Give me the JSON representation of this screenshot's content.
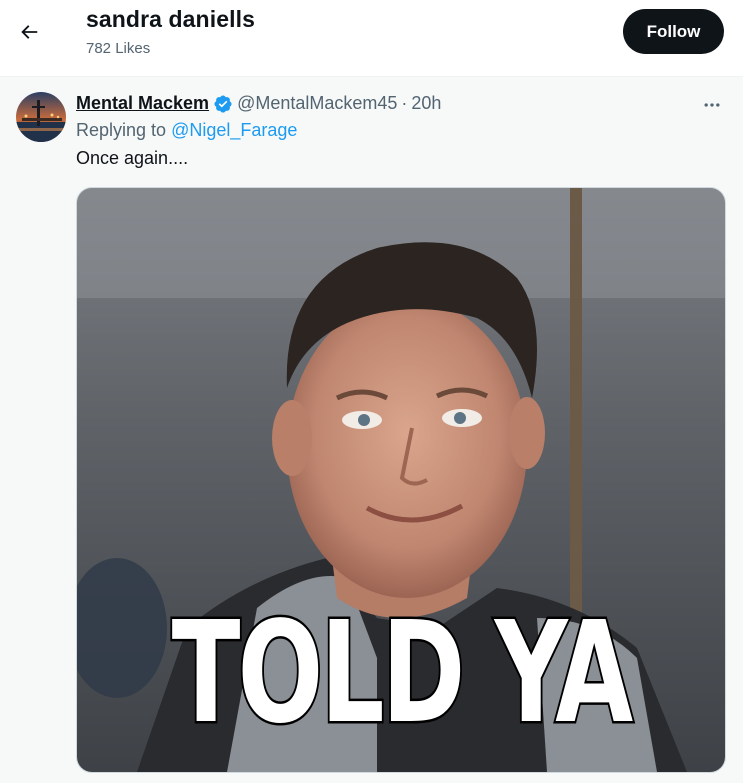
{
  "header": {
    "title": "sandra daniells",
    "likes_count": "782 Likes",
    "follow_label": "Follow",
    "back_icon": "arrow-left-icon"
  },
  "tweet": {
    "author": {
      "display_name": "Mental Mackem",
      "handle": "@MentalMackem45",
      "verified": true
    },
    "separator": "·",
    "time": "20h",
    "reply": {
      "prefix": "Replying to ",
      "target": "@Nigel_Farage"
    },
    "text": "Once again....",
    "media": {
      "caption": "TOLD YA"
    },
    "more_icon": "more-horizontal-icon"
  },
  "colors": {
    "link": "#1d9bf0",
    "verified": "#1d9bf0",
    "follow_bg": "#0f1419",
    "secondary_text": "#536471"
  }
}
